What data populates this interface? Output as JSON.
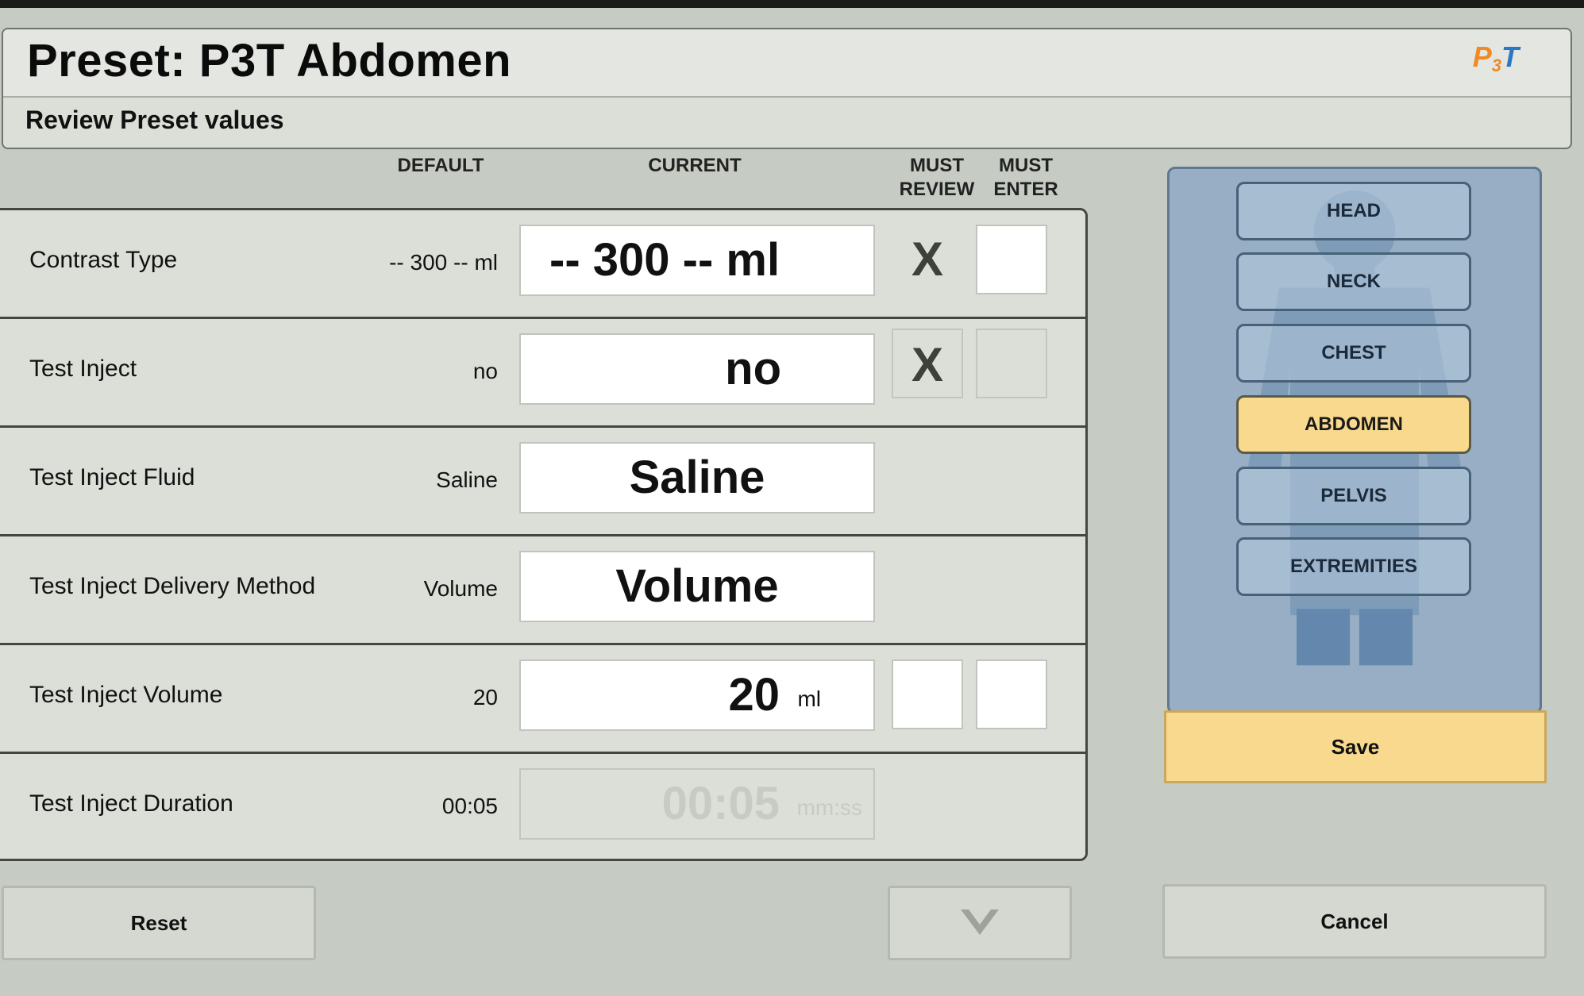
{
  "header": {
    "title": "Preset: P3T Abdomen",
    "subtitle": "Review Preset values",
    "logo": {
      "p": "P",
      "three": "3",
      "t": "T"
    }
  },
  "columns": {
    "default": "DEFAULT",
    "current": "CURRENT",
    "must_review": "MUST\nREVIEW",
    "must_enter": "MUST\nENTER"
  },
  "rows": [
    {
      "label": "Contrast Type",
      "default": "-- 300 -- ml",
      "current": "-- 300 -- ml",
      "unit": "",
      "must_review": "X",
      "must_enter": ""
    },
    {
      "label": "Test Inject",
      "default": "no",
      "current": "no",
      "unit": "",
      "must_review": "X",
      "must_enter": ""
    },
    {
      "label": "Test Inject Fluid",
      "default": "Saline",
      "current": "Saline",
      "unit": ""
    },
    {
      "label": "Test Inject Delivery Method",
      "default": "Volume",
      "current": "Volume",
      "unit": ""
    },
    {
      "label": "Test Inject Volume",
      "default": "20",
      "current": "20",
      "unit": "ml",
      "must_review": "",
      "must_enter": ""
    },
    {
      "label": "Test Inject Duration",
      "default": "00:05",
      "current": "00:05",
      "unit": "mm:ss"
    }
  ],
  "regions": [
    {
      "label": "HEAD",
      "selected": false
    },
    {
      "label": "NECK",
      "selected": false
    },
    {
      "label": "CHEST",
      "selected": false
    },
    {
      "label": "ABDOMEN",
      "selected": true
    },
    {
      "label": "PELVIS",
      "selected": false
    },
    {
      "label": "EXTREMITIES",
      "selected": false
    }
  ],
  "buttons": {
    "save": "Save",
    "reset": "Reset",
    "cancel": "Cancel",
    "scroll_down_icon": "chevron-down-icon"
  },
  "colors": {
    "background": "#c6cbc3",
    "panel": "#dcdfd8",
    "highlight": "#f8d98e",
    "body_panel": "#97aec4",
    "logo_orange": "#f08a22",
    "logo_blue": "#2b78c2"
  }
}
